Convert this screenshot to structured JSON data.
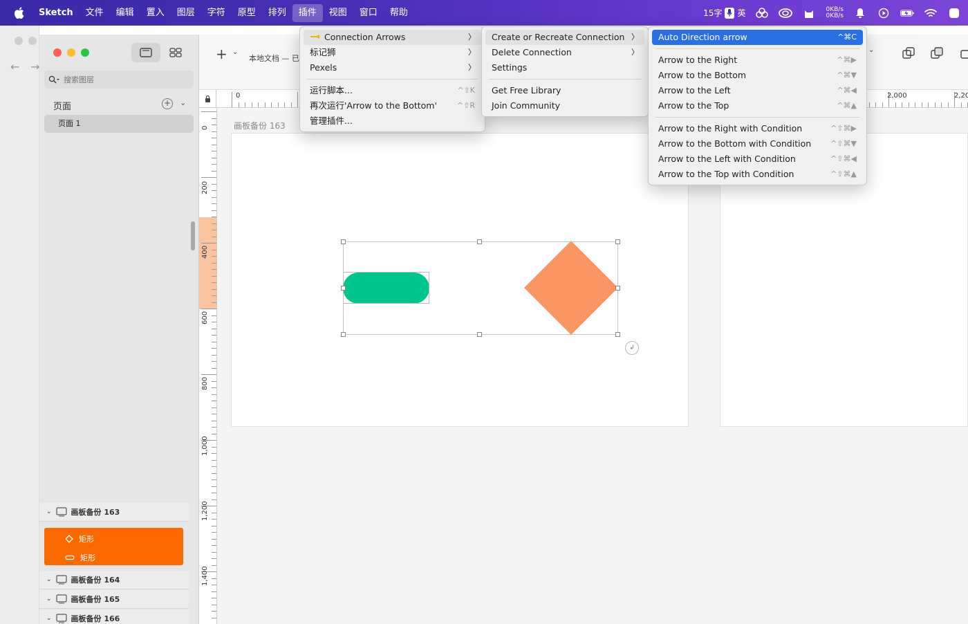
{
  "menubar": {
    "app": "Sketch",
    "items": [
      "文件",
      "编辑",
      "置入",
      "图层",
      "字符",
      "原型",
      "排列",
      "插件",
      "视图",
      "窗口",
      "帮助"
    ],
    "active_index": 7,
    "input_status": "15字",
    "input_lang": "英",
    "net_up": "0KB/s",
    "net_down": "0KB/s"
  },
  "sidebar": {
    "search_placeholder": "搜索图层",
    "pages_header": "页面",
    "page_item": "页面 1",
    "layers": [
      {
        "name": "画板备份 163"
      },
      {
        "name": "画板备份 164"
      },
      {
        "name": "画板备份 165"
      },
      {
        "name": "画板备份 166"
      }
    ],
    "selected_layers": [
      "矩形",
      "矩形"
    ]
  },
  "toolbar": {
    "doc_title": "本地文档 — 已"
  },
  "rulers": {
    "h_labels": [
      "0",
      "2,000",
      "2,20"
    ],
    "v_labels": [
      "0",
      "200",
      "400",
      "600",
      "800",
      "1,000",
      "1,200",
      "1,400"
    ]
  },
  "canvas": {
    "artboard_label": "画板备份 163",
    "colors": {
      "pill": "#00c58e",
      "diamond": "#fa9562",
      "selected_layer": "#fa6a00"
    }
  },
  "menus": {
    "plugins": {
      "items": [
        {
          "label": "Connection Arrows",
          "icon": "pointing-hand-icon",
          "submenu": true
        },
        {
          "label": "标记狮",
          "submenu": true
        },
        {
          "label": "Pexels",
          "submenu": true
        },
        {
          "label": "运行脚本...",
          "shortcut": "^⇧K"
        },
        {
          "label": "再次运行'Arrow to the Bottom'",
          "shortcut": "^⇧R"
        },
        {
          "label": "管理插件..."
        }
      ]
    },
    "connection": {
      "items": [
        {
          "label": "Create or Recreate Connection",
          "submenu": true
        },
        {
          "label": "Delete Connection",
          "submenu": true
        },
        {
          "label": "Settings"
        },
        {
          "label": "Get Free Library"
        },
        {
          "label": "Join Community"
        }
      ]
    },
    "create": {
      "items": [
        {
          "label": "Auto Direction arrow",
          "shortcut": "^⌘C"
        },
        {
          "label": "Arrow to the Right",
          "shortcut": "^⌘▶"
        },
        {
          "label": "Arrow to the Bottom",
          "shortcut": "^⌘▼"
        },
        {
          "label": "Arrow to the Left",
          "shortcut": "^⌘◀"
        },
        {
          "label": "Arrow to the Top",
          "shortcut": "^⌘▲"
        },
        {
          "label": "Arrow to the Right with Condition",
          "shortcut": "^⇧⌘▶"
        },
        {
          "label": "Arrow to the Bottom with Condition",
          "shortcut": "^⇧⌘▼"
        },
        {
          "label": "Arrow to the Left with Condition",
          "shortcut": "^⇧⌘◀"
        },
        {
          "label": "Arrow to the Top with Condition",
          "shortcut": "^⇧⌘▲"
        }
      ]
    }
  }
}
